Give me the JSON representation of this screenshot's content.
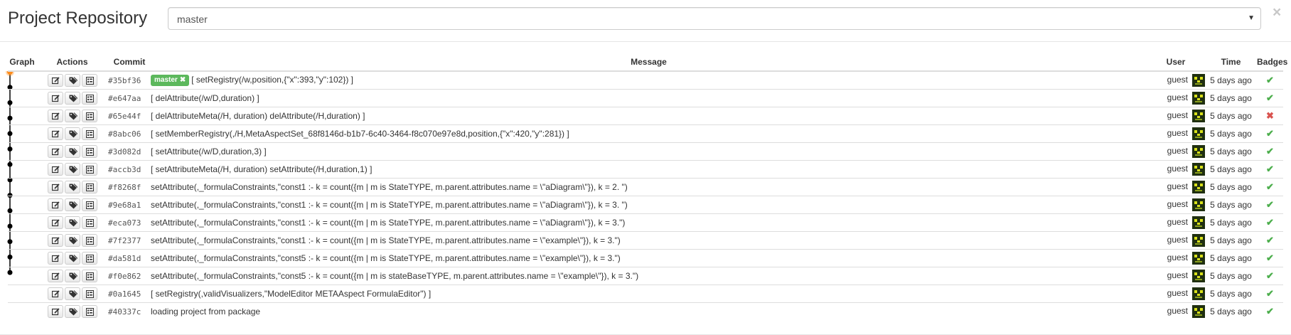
{
  "header": {
    "title": "Project Repository",
    "branch_selected": "master",
    "close_symbol": "×"
  },
  "columns": {
    "graph": "Graph",
    "actions": "Actions",
    "commit": "Commit",
    "message": "Message",
    "user": "User",
    "time": "Time",
    "badges": "Badges"
  },
  "head_branch_label": "master",
  "colors": {
    "head_node": "#ff8c1a",
    "branch_label_bg": "#5cb85c",
    "ok_badge": "#4cae4c",
    "fail_badge": "#d9534f"
  },
  "commits": [
    {
      "hash": "#35bf36",
      "message": "[ setRegistry(/w,position,{\"x\":393,\"y\":102}) ]",
      "user": "guest",
      "time": "5 days ago",
      "badge": "ok",
      "head": true
    },
    {
      "hash": "#e647aa",
      "message": "[ delAttribute(/w/D,duration) ]",
      "user": "guest",
      "time": "5 days ago",
      "badge": "ok"
    },
    {
      "hash": "#65e44f",
      "message": "[ delAttributeMeta(/H, duration) delAttribute(/H,duration) ]",
      "user": "guest",
      "time": "5 days ago",
      "badge": "fail"
    },
    {
      "hash": "#8abc06",
      "message": "[ setMemberRegistry(,/H,MetaAspectSet_68f8146d-b1b7-6c40-3464-f8c070e97e8d,position,{\"x\":420,\"y\":281}) ]",
      "user": "guest",
      "time": "5 days ago",
      "badge": "ok"
    },
    {
      "hash": "#3d082d",
      "message": "[ setAttribute(/w/D,duration,3) ]",
      "user": "guest",
      "time": "5 days ago",
      "badge": "ok"
    },
    {
      "hash": "#accb3d",
      "message": "[ setAttributeMeta(/H, duration) setAttribute(/H,duration,1) ]",
      "user": "guest",
      "time": "5 days ago",
      "badge": "ok"
    },
    {
      "hash": "#f8268f",
      "message": "setAttribute(,_formulaConstraints,\"const1 :- k = count({m | m is StateTYPE, m.parent.attributes.name = \\\"aDiagram\\\"}), k = 2. \")",
      "user": "guest",
      "time": "5 days ago",
      "badge": "ok"
    },
    {
      "hash": "#9e68a1",
      "message": "setAttribute(,_formulaConstraints,\"const1 :- k = count({m | m is StateTYPE, m.parent.attributes.name = \\\"aDiagram\\\"}), k = 3. \")",
      "user": "guest",
      "time": "5 days ago",
      "badge": "ok"
    },
    {
      "hash": "#eca073",
      "message": "setAttribute(,_formulaConstraints,\"const1 :- k = count({m | m is StateTYPE, m.parent.attributes.name = \\\"aDiagram\\\"}), k = 3.\")",
      "user": "guest",
      "time": "5 days ago",
      "badge": "ok"
    },
    {
      "hash": "#7f2377",
      "message": "setAttribute(,_formulaConstraints,\"const1 :- k = count({m | m is StateTYPE, m.parent.attributes.name = \\\"example\\\"}), k = 3.\")",
      "user": "guest",
      "time": "5 days ago",
      "badge": "ok"
    },
    {
      "hash": "#da581d",
      "message": "setAttribute(,_formulaConstraints,\"const5 :- k = count({m | m is StateTYPE, m.parent.attributes.name = \\\"example\\\"}), k = 3.\")",
      "user": "guest",
      "time": "5 days ago",
      "badge": "ok"
    },
    {
      "hash": "#f0e862",
      "message": "setAttribute(,_formulaConstraints,\"const5 :- k = count({m | m is stateBaseTYPE, m.parent.attributes.name = \\\"example\\\"}), k = 3.\")",
      "user": "guest",
      "time": "5 days ago",
      "badge": "ok"
    },
    {
      "hash": "#0a1645",
      "message": "[ setRegistry(,validVisualizers,\"ModelEditor METAAspect FormulaEditor\") ]",
      "user": "guest",
      "time": "5 days ago",
      "badge": "ok"
    },
    {
      "hash": "#40337c",
      "message": "loading project from package",
      "user": "guest",
      "time": "5 days ago",
      "badge": "ok"
    }
  ],
  "badge_symbols": {
    "ok": "✔",
    "fail": "✖"
  },
  "action_icons": [
    "edit-icon",
    "tag-icon",
    "list-details-icon"
  ]
}
